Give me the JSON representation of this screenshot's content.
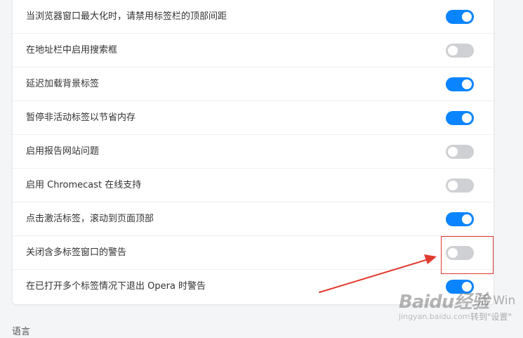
{
  "settings": {
    "rows": [
      {
        "label": "当浏览器窗口最大化时，请禁用标签栏的顶部间距",
        "enabled": true
      },
      {
        "label": "在地址栏中启用搜索框",
        "enabled": false
      },
      {
        "label": "延迟加载背景标签",
        "enabled": true
      },
      {
        "label": "暂停非活动标签以节省内存",
        "enabled": true
      },
      {
        "label": "启用报告网站问题",
        "enabled": false
      },
      {
        "label": "启用 Chromecast 在线支持",
        "enabled": false
      },
      {
        "label": "点击激活标签，滚动到页面顶部",
        "enabled": true
      },
      {
        "label": "关闭含多标签窗口的警告",
        "enabled": false
      },
      {
        "label": "在已打开多个标签情况下退出 Opera 时警告",
        "enabled": true
      }
    ]
  },
  "next_section": {
    "heading": "语言"
  },
  "annotation": {
    "color": "#e03a2f",
    "target_row": "关闭含多标签窗口的警告"
  },
  "watermark": {
    "logo": "Baidu经验",
    "site": "jingyan.baidu.com",
    "windows_line1": "活 Win",
    "windows_line2": "转到\"设置\""
  },
  "colors": {
    "toggle_on": "#0a84ff",
    "toggle_off": "#cfd0d3",
    "page_bg": "#f4f5f7",
    "panel_bg": "#ffffff"
  }
}
